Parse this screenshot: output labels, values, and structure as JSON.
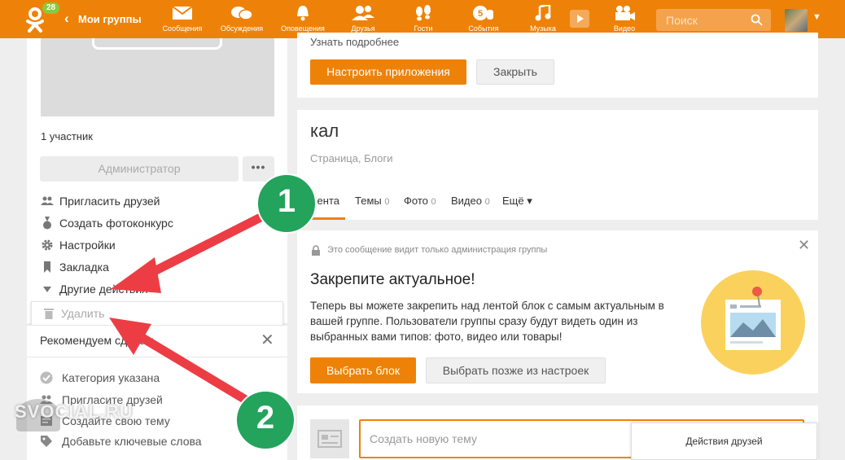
{
  "topbar": {
    "notification_count": "28",
    "back_label": "Мои группы",
    "nav": [
      {
        "label": "Сообщения",
        "icon": "envelope-icon"
      },
      {
        "label": "Обсуждения",
        "icon": "chat-bubbles-icon"
      },
      {
        "label": "Оповещения",
        "icon": "bell-icon"
      },
      {
        "label": "Друзья",
        "icon": "friends-icon"
      },
      {
        "label": "Гости",
        "icon": "footprints-icon"
      },
      {
        "label": "События",
        "icon": "events-hand-icon"
      },
      {
        "label": "Музыка",
        "icon": "music-note-icon"
      },
      {
        "label": "Видео",
        "icon": "video-camera-icon"
      }
    ],
    "search_placeholder": "Поиск"
  },
  "left": {
    "members": "1 участник",
    "admin_button": "Администратор",
    "more_button": "•••",
    "menu": [
      {
        "label": "Пригласить друзей",
        "icon": "people-icon"
      },
      {
        "label": "Создать фотоконкурс",
        "icon": "medal-icon"
      },
      {
        "label": "Настройки",
        "icon": "gear-icon"
      },
      {
        "label": "Закладка",
        "icon": "bookmark-icon"
      },
      {
        "label": "Другие действия",
        "icon": "triangle-down-icon"
      }
    ],
    "delete_label": "Удалить",
    "recommend": {
      "title": "Рекомендуем сделать",
      "items": [
        {
          "label": "Категория указана",
          "icon": "check-circle-icon"
        },
        {
          "label": "Пригласите друзей",
          "icon": "people-icon"
        },
        {
          "label": "Создайте свою тему",
          "icon": "topic-icon"
        },
        {
          "label": "Добавьте ключевые слова",
          "icon": "tag-icon"
        }
      ]
    }
  },
  "main": {
    "learn_more": "Узнать подробнее",
    "setup_apps_button": "Настроить приложения",
    "close_button": "Закрыть",
    "group_name": "кал",
    "group_category": "Страница, Блоги",
    "tabs": [
      {
        "label": "Лента",
        "count": ""
      },
      {
        "label": "Темы",
        "count": "0"
      },
      {
        "label": "Фото",
        "count": "0"
      },
      {
        "label": "Видео",
        "count": "0"
      },
      {
        "label": "Ещё ▾",
        "count": ""
      }
    ],
    "admin_notice": "Это сообщение видит только администрация группы",
    "pin_title": "Закрепите актуальное!",
    "pin_text": "Теперь вы можете закрепить над лентой блок с самым актуальным в вашей группе. Пользователи группы сразу будут видеть один из выбранных вами типов: фото, видео или товары!",
    "choose_block_button": "Выбрать блок",
    "later_button": "Выбрать позже из настроек",
    "new_topic_placeholder": "Создать новую тему",
    "friends_actions": "Действия друзей"
  },
  "annotations": {
    "marker_1": "1",
    "marker_2": "2",
    "watermark": "SVOCIAL.RU"
  },
  "colors": {
    "brand_orange": "#ee8208",
    "marker_green": "#23a35c",
    "arrow_red": "#ec3d45"
  }
}
